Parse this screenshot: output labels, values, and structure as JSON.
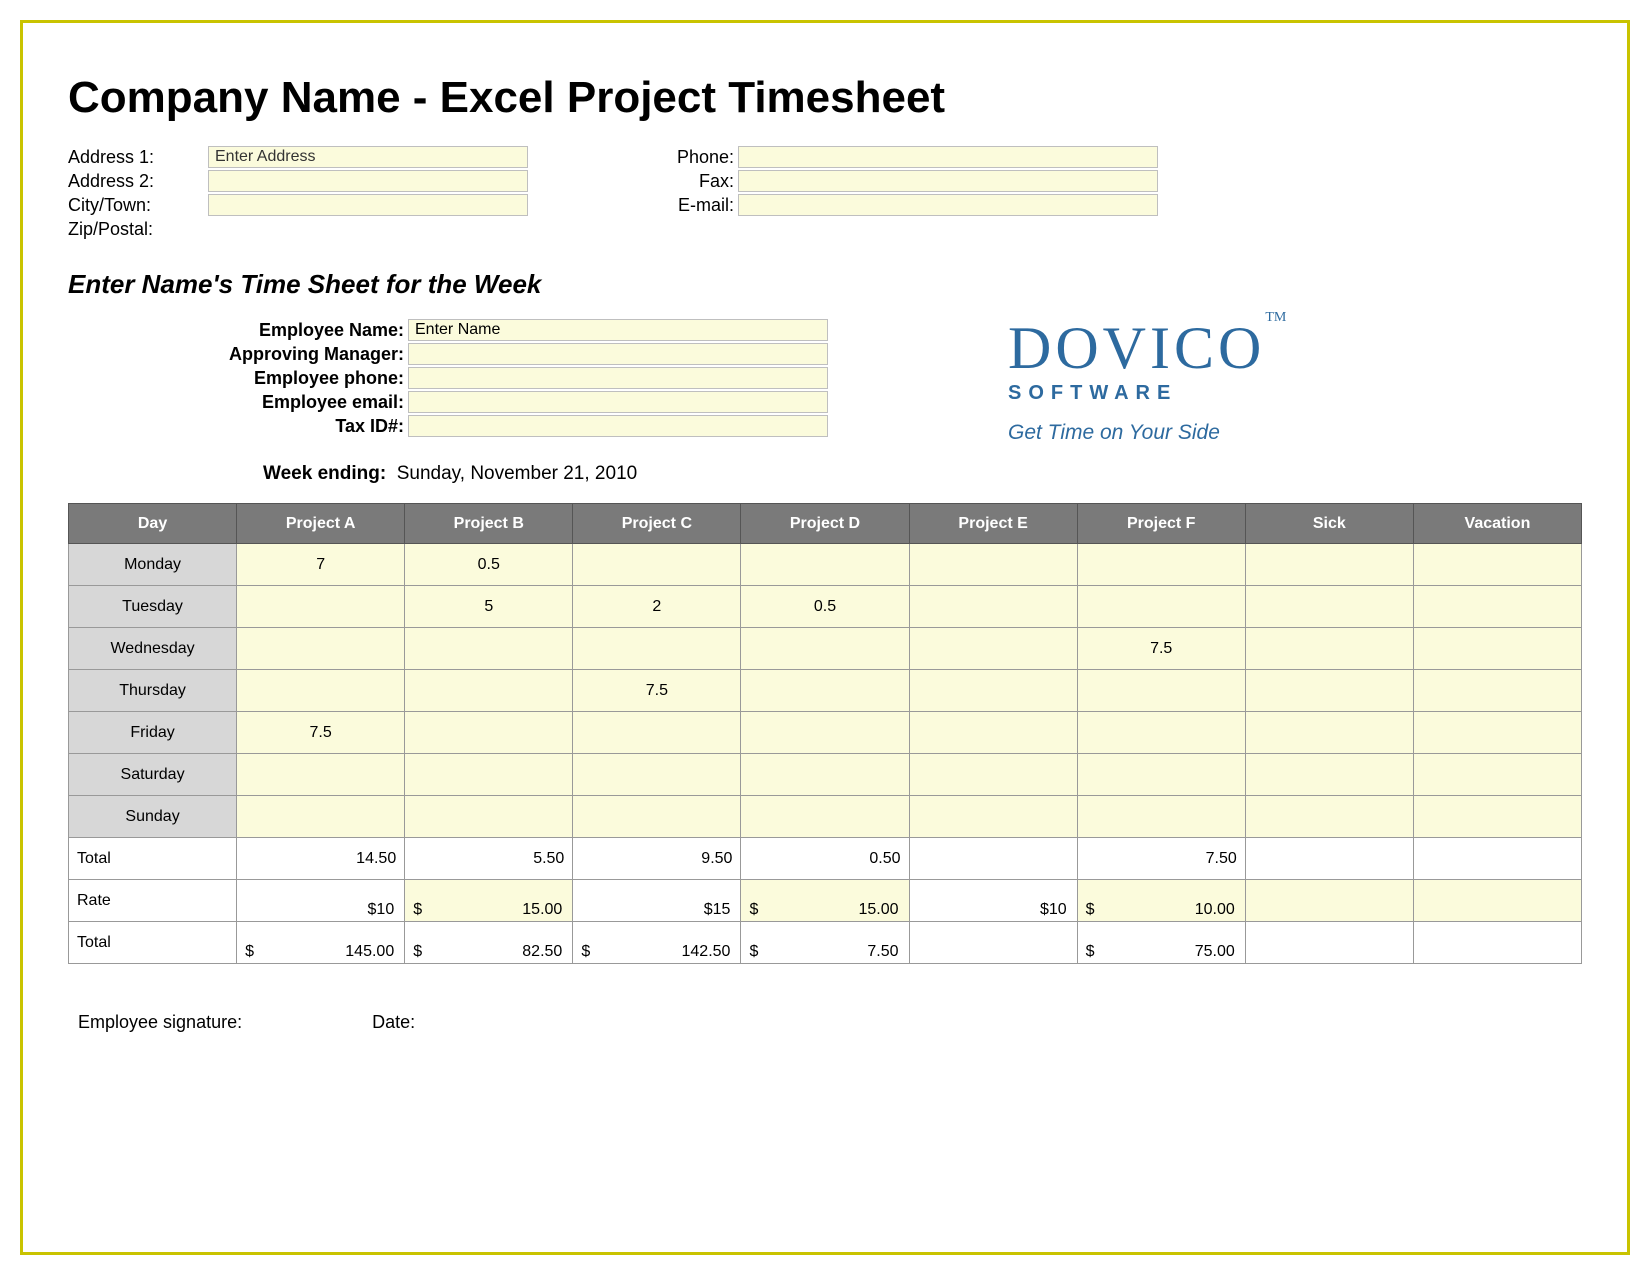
{
  "title": "Company Name - Excel Project Timesheet",
  "company_info": {
    "left_labels": [
      "Address 1:",
      "Address 2:",
      "City/Town:",
      "Zip/Postal:"
    ],
    "left_values": [
      "Enter Address",
      "",
      "",
      ""
    ],
    "right_labels": [
      "Phone:",
      "Fax:",
      "E-mail:"
    ],
    "right_values": [
      "",
      "",
      ""
    ]
  },
  "subtitle": "Enter Name's Time Sheet for the Week",
  "employee": {
    "labels": [
      "Employee Name:",
      "Approving Manager:",
      "Employee phone:",
      "Employee email:",
      "Tax ID#:"
    ],
    "values": [
      "Enter Name",
      "",
      "",
      "",
      ""
    ]
  },
  "logo": {
    "name": "DOVICO",
    "tm": "TM",
    "software": "SOFTWARE",
    "tagline": "Get Time on Your Side"
  },
  "week_ending_label": "Week ending:",
  "week_ending_value": "Sunday, November 21, 2010",
  "columns": [
    "Day",
    "Project A",
    "Project B",
    "Project C",
    "Project D",
    "Project E",
    "Project F",
    "Sick",
    "Vacation"
  ],
  "days": [
    "Monday",
    "Tuesday",
    "Wednesday",
    "Thursday",
    "Friday",
    "Saturday",
    "Sunday"
  ],
  "entries": {
    "Monday": [
      "7",
      "0.5",
      "",
      "",
      "",
      "",
      "",
      ""
    ],
    "Tuesday": [
      "",
      "5",
      "2",
      "0.5",
      "",
      "",
      "",
      ""
    ],
    "Wednesday": [
      "",
      "",
      "",
      "",
      "",
      "7.5",
      "",
      ""
    ],
    "Thursday": [
      "",
      "",
      "7.5",
      "",
      "",
      "",
      "",
      ""
    ],
    "Friday": [
      "7.5",
      "",
      "",
      "",
      "",
      "",
      "",
      ""
    ],
    "Saturday": [
      "",
      "",
      "",
      "",
      "",
      "",
      "",
      ""
    ],
    "Sunday": [
      "",
      "",
      "",
      "",
      "",
      "",
      "",
      ""
    ]
  },
  "summary": {
    "total_label": "Total",
    "totals": [
      "14.50",
      "5.50",
      "9.50",
      "0.50",
      "",
      "7.50",
      "",
      ""
    ],
    "rate_label": "Rate",
    "rates": [
      {
        "sym": "",
        "amt": "$10"
      },
      {
        "sym": "$",
        "amt": "15.00"
      },
      {
        "sym": "",
        "amt": "$15"
      },
      {
        "sym": "$",
        "amt": "15.00"
      },
      {
        "sym": "",
        "amt": "$10"
      },
      {
        "sym": "$",
        "amt": "10.00"
      },
      {
        "sym": "",
        "amt": ""
      },
      {
        "sym": "",
        "amt": ""
      }
    ],
    "line_total_label": "Total",
    "line_totals": [
      {
        "sym": "$",
        "amt": "145.00"
      },
      {
        "sym": "$",
        "amt": "82.50"
      },
      {
        "sym": "$",
        "amt": "142.50"
      },
      {
        "sym": "$",
        "amt": "7.50"
      },
      {
        "sym": "",
        "amt": ""
      },
      {
        "sym": "$",
        "amt": "75.00"
      },
      {
        "sym": "",
        "amt": ""
      },
      {
        "sym": "",
        "amt": ""
      }
    ]
  },
  "signature": {
    "employee_sig": "Employee signature:",
    "date": "Date:"
  }
}
